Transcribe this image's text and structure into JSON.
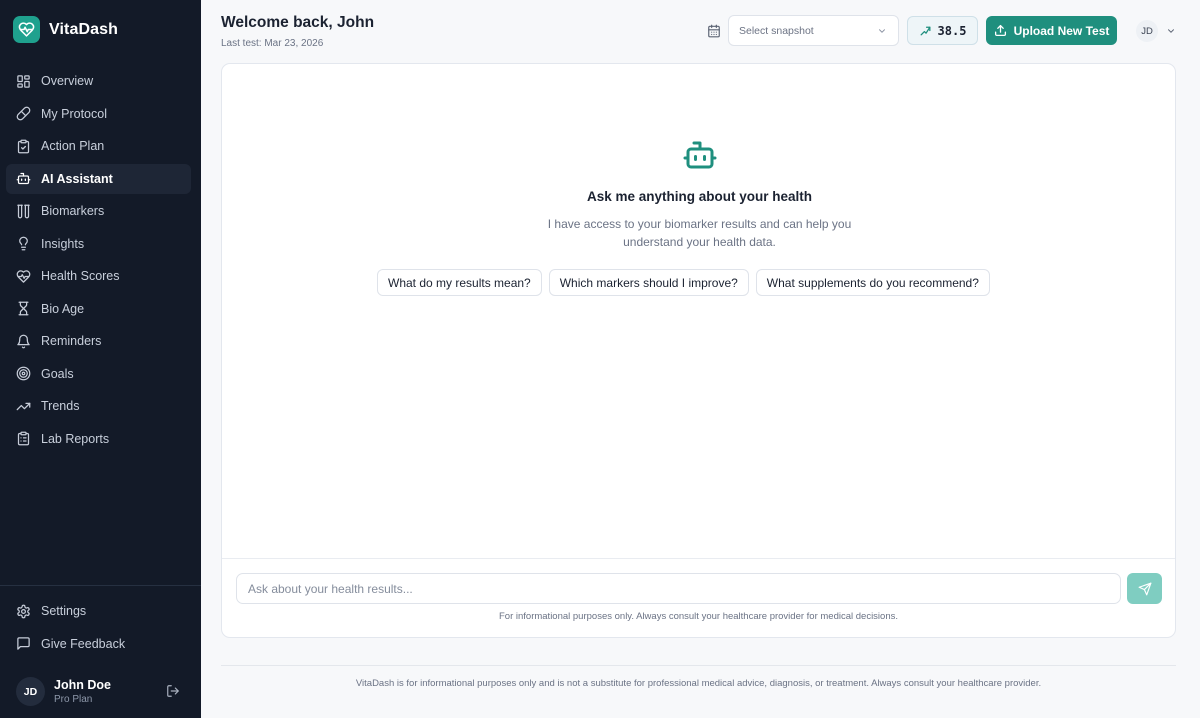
{
  "app": {
    "name": "VitaDash"
  },
  "colors": {
    "sidebar_bg": "#131a28",
    "accent": "#1f8f7e",
    "send_disabled": "#7fcdc1"
  },
  "sidebar": {
    "items": [
      {
        "label": "Overview",
        "icon": "grid-icon"
      },
      {
        "label": "My Protocol",
        "icon": "pill-icon"
      },
      {
        "label": "Action Plan",
        "icon": "clipboard-check-icon"
      },
      {
        "label": "AI Assistant",
        "icon": "bot-icon",
        "active": true
      },
      {
        "label": "Biomarkers",
        "icon": "test-tubes-icon"
      },
      {
        "label": "Insights",
        "icon": "lightbulb-icon"
      },
      {
        "label": "Health Scores",
        "icon": "heart-pulse-icon"
      },
      {
        "label": "Bio Age",
        "icon": "hourglass-icon"
      },
      {
        "label": "Reminders",
        "icon": "bell-icon"
      },
      {
        "label": "Goals",
        "icon": "target-icon"
      },
      {
        "label": "Trends",
        "icon": "trending-up-icon"
      },
      {
        "label": "Lab Reports",
        "icon": "clipboard-list-icon"
      }
    ],
    "bottom_items": [
      {
        "label": "Settings",
        "icon": "gear-icon"
      },
      {
        "label": "Give Feedback",
        "icon": "message-square-icon"
      }
    ],
    "user": {
      "initials": "JD",
      "name": "John Doe",
      "plan": "Pro Plan"
    }
  },
  "header": {
    "title": "Welcome back, John",
    "subtitle": "Last test: Mar 23, 2026",
    "snapshot_placeholder": "Select snapshot",
    "score": "38.5",
    "upload_label": "Upload New Test",
    "avatar_initials": "JD"
  },
  "chat": {
    "title": "Ask me anything about your health",
    "description": "I have access to your biomarker results and can help you understand your health data.",
    "suggestions": [
      "What do my results mean?",
      "Which markers should I improve?",
      "What supplements do you recommend?"
    ],
    "input_placeholder": "Ask about your health results...",
    "disclaimer": "For informational purposes only. Always consult your healthcare provider for medical decisions."
  },
  "footer": {
    "text": "VitaDash is for informational purposes only and is not a substitute for professional medical advice, diagnosis, or treatment. Always consult your healthcare provider."
  }
}
